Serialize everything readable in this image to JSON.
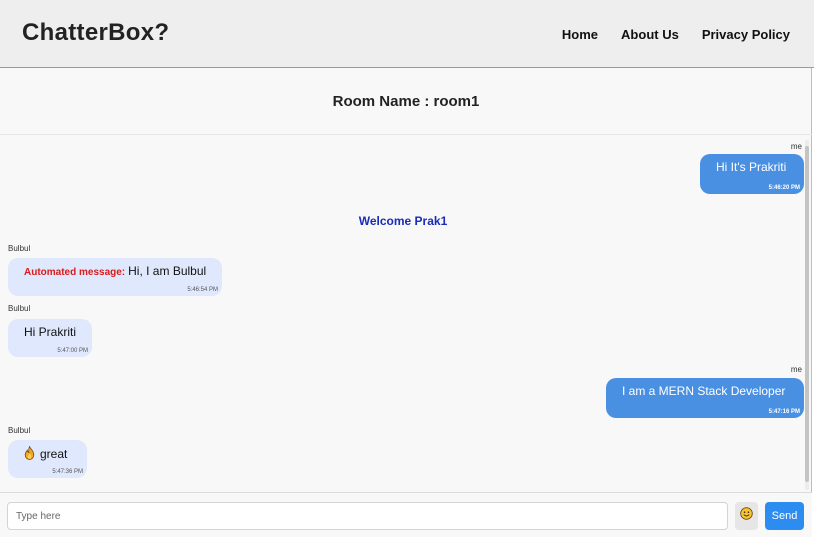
{
  "navbar": {
    "brand": "ChatterBox?",
    "links": [
      "Home",
      "About Us",
      "Privacy Policy"
    ]
  },
  "room": {
    "title": "Room Name : room1"
  },
  "messages": [
    {
      "sender": "me",
      "text": "Hi It's Prakriti",
      "time": "5:46:20 PM",
      "own": true
    },
    {
      "type": "system",
      "text": "Welcome Prak1"
    },
    {
      "sender": "Bulbul",
      "prefix": "Automated message:",
      "text": "Hi, I am Bulbul",
      "time": "5:46:54 PM",
      "own": false
    },
    {
      "sender": "Bulbul",
      "text": "Hi Prakriti",
      "time": "5:47:00 PM",
      "own": false
    },
    {
      "sender": "me",
      "text": "I am a MERN Stack Developer",
      "time": "5:47:16 PM",
      "own": true
    },
    {
      "sender": "Bulbul",
      "icon": "fire-emoji",
      "text": "great",
      "time": "5:47:36 PM",
      "own": false
    }
  ],
  "composer": {
    "placeholder": "Type here",
    "emoji_icon": "smiley-emoji",
    "send_label": "Send"
  },
  "colors": {
    "own_bubble": "#4a90e2",
    "other_bubble": "#dfe8fc",
    "system_text": "#1a2bb8",
    "automated_prefix": "#d81b1b",
    "send_button": "#2d8cf0"
  }
}
